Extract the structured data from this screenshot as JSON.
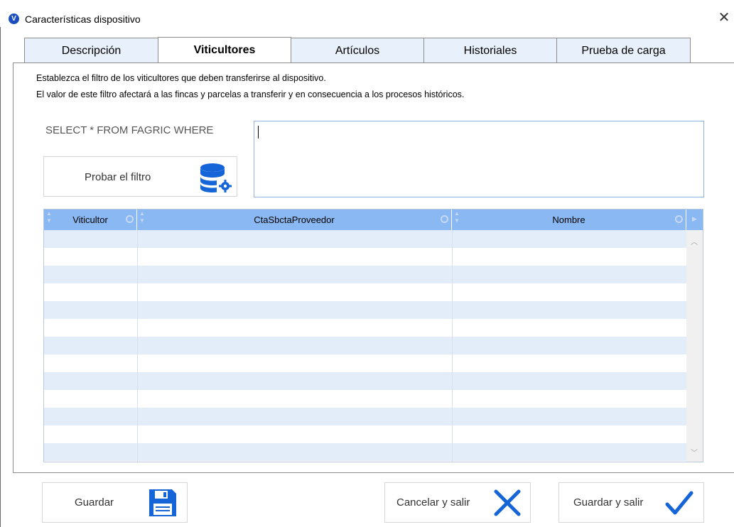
{
  "window": {
    "title": "Características dispositivo",
    "close_glyph": "✕"
  },
  "tabs": [
    {
      "label": "Descripción",
      "active": false
    },
    {
      "label": "Viticultores",
      "active": true
    },
    {
      "label": "Artículos",
      "active": false
    },
    {
      "label": "Historiales",
      "active": false
    },
    {
      "label": "Prueba de carga",
      "active": false
    }
  ],
  "viticultores": {
    "description_line1": "Establezca el filtro de los viticultores que deben transferirse al dispositivo.",
    "description_line2": "El valor de este filtro afectará a las fincas y parcelas a transferir y en consecuencia a los procesos históricos.",
    "select_label": "SELECT * FROM FAGRIC WHERE",
    "filter_value": "",
    "test_filter_button": "Probar el filtro",
    "test_filter_icon": "database-gear-icon"
  },
  "grid": {
    "columns": [
      "Viticultor",
      "CtaSbctaProveedor",
      "Nombre"
    ],
    "rows": [],
    "header_color": "#8ab8f2",
    "alt_row_color": "#e3edf9"
  },
  "footer": {
    "save_label": "Guardar",
    "save_icon": "floppy-disk-icon",
    "cancel_label": "Cancelar y salir",
    "cancel_icon": "x-icon",
    "save_exit_label": "Guardar y salir",
    "save_exit_icon": "checkmark-icon",
    "accent_color": "#1565d8"
  }
}
